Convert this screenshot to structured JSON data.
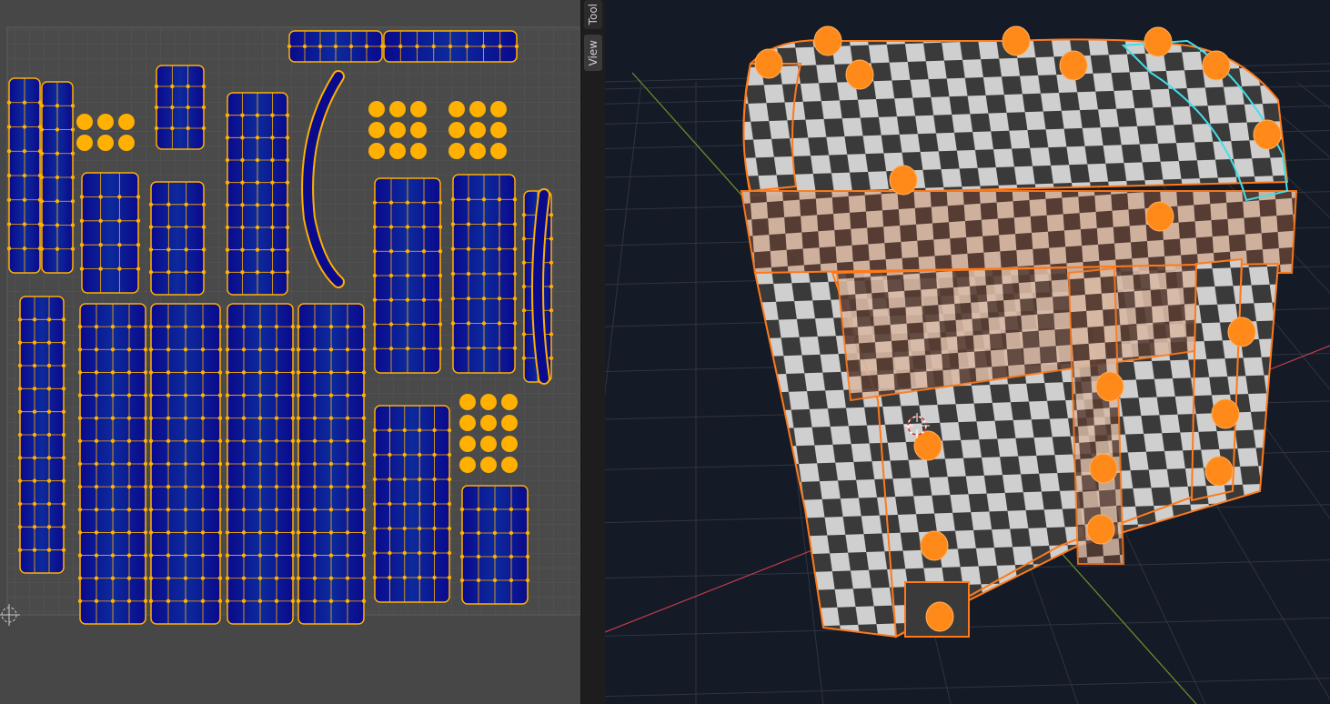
{
  "sidebar": {
    "tabs": [
      {
        "label": "Tool"
      },
      {
        "label": "View"
      }
    ]
  },
  "colors": {
    "uv_background": "#474747",
    "uv_grid": "#575757",
    "uv_island_fill": "#0a0a8c",
    "uv_selected_vertex": "#ffb000",
    "viewport_background": "#141a26",
    "viewport_grid": "#3a3f4a",
    "x_axis": "#b43c46",
    "y_axis": "#6a8a2a",
    "selection_outline": "#ff7a1a",
    "checker_dark": "#3a3a3a",
    "checker_light": "#d0d0d0"
  },
  "icons": {
    "cursor": "2d-cursor-icon",
    "viewport_cursor": "3d-cursor-icon"
  }
}
